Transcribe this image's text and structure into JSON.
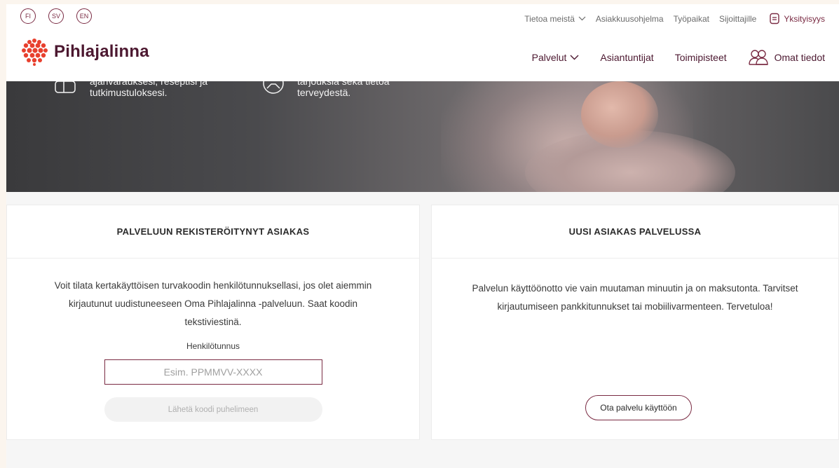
{
  "languages": [
    "FI",
    "SV",
    "EN"
  ],
  "topnav": {
    "about": "Tietoa meistä",
    "loyalty": "Asiakkuusohjelma",
    "jobs": "Työpaikat",
    "investors": "Sijoittajille",
    "privacy": "Yksityisyys"
  },
  "brand": {
    "name": "Pihlajalinna"
  },
  "mainnav": {
    "services": "Palvelut",
    "experts": "Asiantuntijat",
    "locations": "Toimipisteet",
    "my_info": "Omat tiedot"
  },
  "hero": {
    "left_line1": "ajanvarauksesi, reseptisi ja",
    "left_line2": "tutkimustuloksesi.",
    "right_line1": "tarjouksia sekä tietoa",
    "right_line2": "terveydestä."
  },
  "registered": {
    "title": "PALVELUUN REKISTERÖITYNYT ASIAKAS",
    "description_line1": "Voit tilata kertakäyttöisen turvakoodin henkilötunnuksellasi, jos olet aiemmin",
    "description_line2": "kirjautunut uudistuneeseen Oma Pihlajalinna -palveluun. Saat koodin",
    "description_line3": "tekstiviestinä.",
    "field_label": "Henkilötunnus",
    "field_placeholder": "Esim. PPMMVV-XXXX",
    "field_value": "",
    "send_button": "Lähetä koodi puhelimeen"
  },
  "new_customer": {
    "title": "UUSI ASIAKAS PALVELUSSA",
    "description_line1": "Palvelun käyttöönotto vie vain muutaman minuutin ja on maksutonta. Tarvitset",
    "description_line2": "kirjautumiseen pankkitunnukset tai mobiilivarmenteen. Tervetuloa!",
    "start_button": "Ota palvelu käyttöön"
  },
  "colors": {
    "brand_maroon": "#7a2b43",
    "brand_dark": "#4c1830",
    "logo_red": "#e8402e"
  }
}
